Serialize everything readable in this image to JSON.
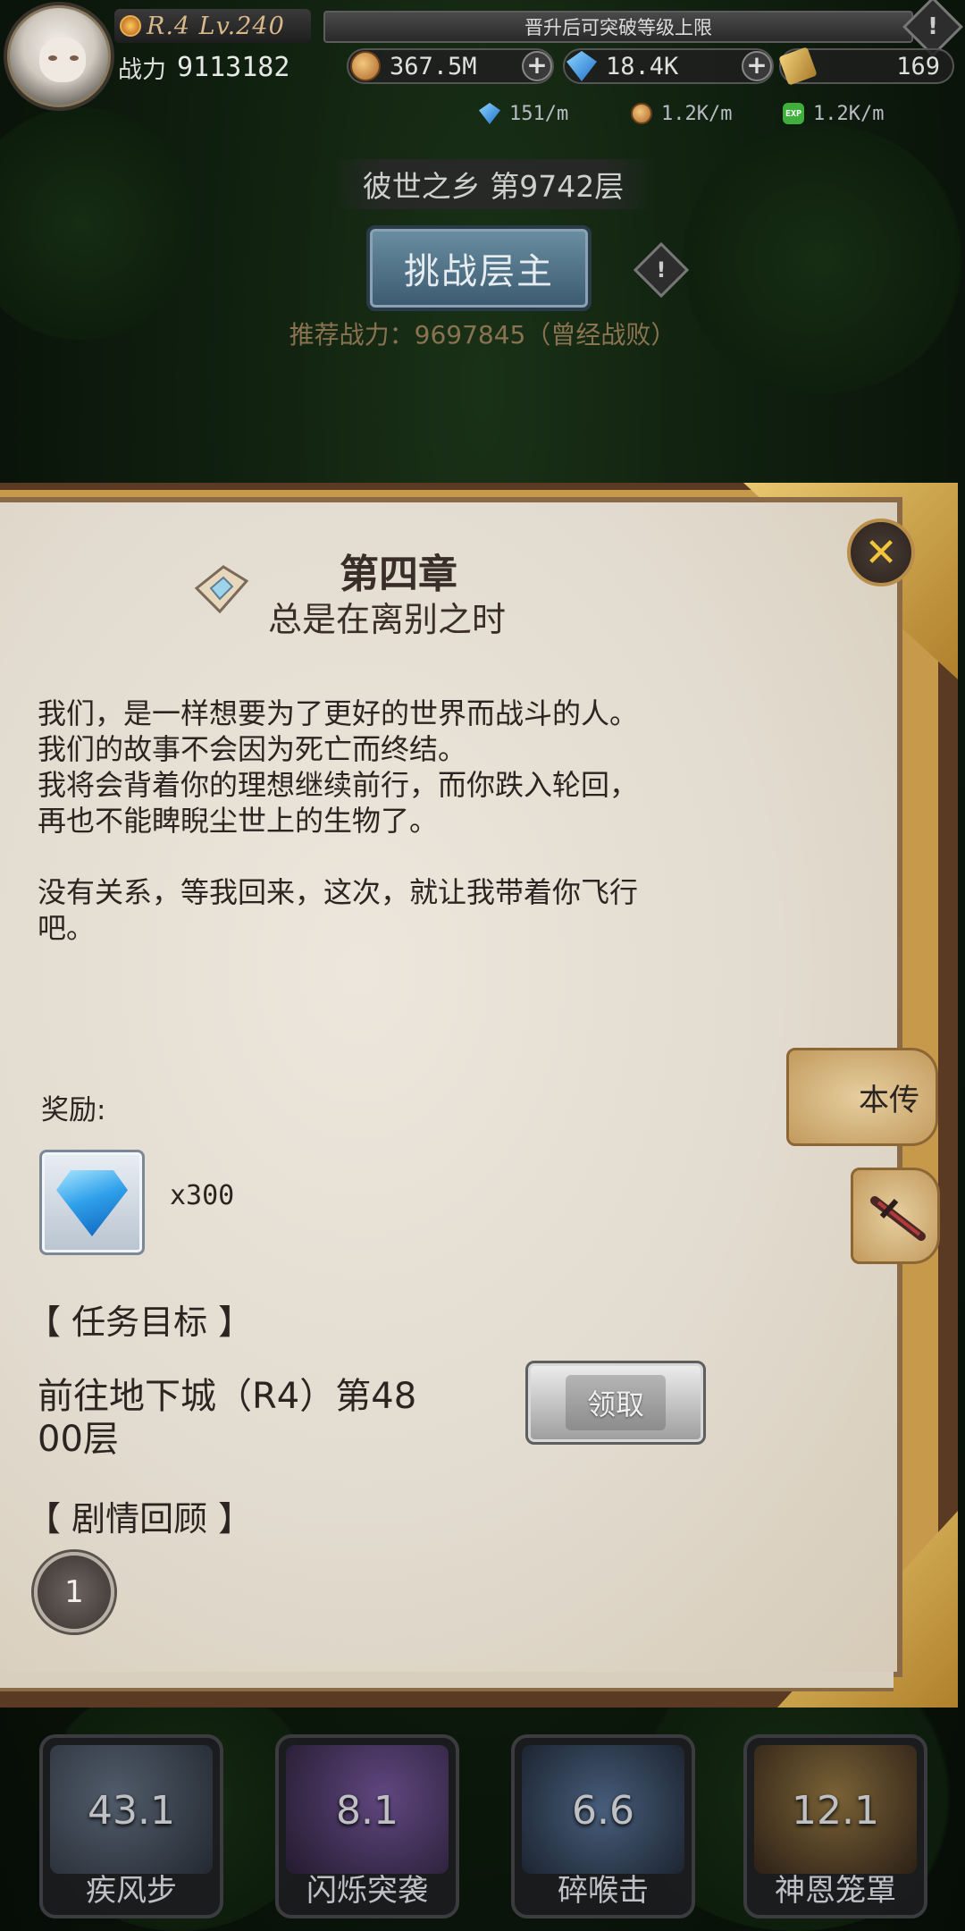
{
  "header": {
    "rank_text": "R.4 Lv.240",
    "notice": "晋升后可突破等级上限",
    "power_label": "战力",
    "power_value": "9113182",
    "resources": [
      {
        "icon": "gold-coin-icon",
        "value": "367.5M"
      },
      {
        "icon": "blue-gem-icon",
        "value": "18.4K"
      },
      {
        "icon": "ticket-icon",
        "value": "169"
      }
    ],
    "rates": [
      {
        "icon": "blue-orb-icon",
        "value": "151/m"
      },
      {
        "icon": "gold-coin-icon",
        "value": "1.2K/m"
      },
      {
        "icon": "exp-icon",
        "value": "1.2K/m",
        "label": "EXP"
      }
    ]
  },
  "stage": {
    "name": "彼世之乡  第9742层",
    "challenge_label": "挑战层主",
    "recommend": "推荐战力：9697845（曾经战败）"
  },
  "chapter": {
    "title": "第四章",
    "subtitle": "总是在离别之时",
    "story": [
      "我们，是一样想要为了更好的世界而战斗的人。",
      "我们的故事不会因为死亡而终结。",
      "我将会背着你的理想继续前行，而你跌入轮回，",
      "再也不能睥睨尘世上的生物了。",
      "没有关系，等我回来，这次，就让我带着你飞行",
      "吧。"
    ],
    "reward_label": "奖励:",
    "reward_count": "x300",
    "task_heading": "【 任务目标 】",
    "task_line1": "前往地下城（R4）第48",
    "task_line2": "00层",
    "claim_label": "领取",
    "review_heading": "【 剧情回顾 】",
    "review_item": "1",
    "side_tab_label": "本传"
  },
  "skills": [
    {
      "name": "疾风步",
      "cooldown": "43.1",
      "color": "#5b6f8a"
    },
    {
      "name": "闪烁突袭",
      "cooldown": "8.1",
      "color": "#5a3b78"
    },
    {
      "name": "碎喉击",
      "cooldown": "6.6",
      "color": "#3b5e8a"
    },
    {
      "name": "神恩笼罩",
      "cooldown": "12.1",
      "color": "#7a5a2c"
    }
  ]
}
